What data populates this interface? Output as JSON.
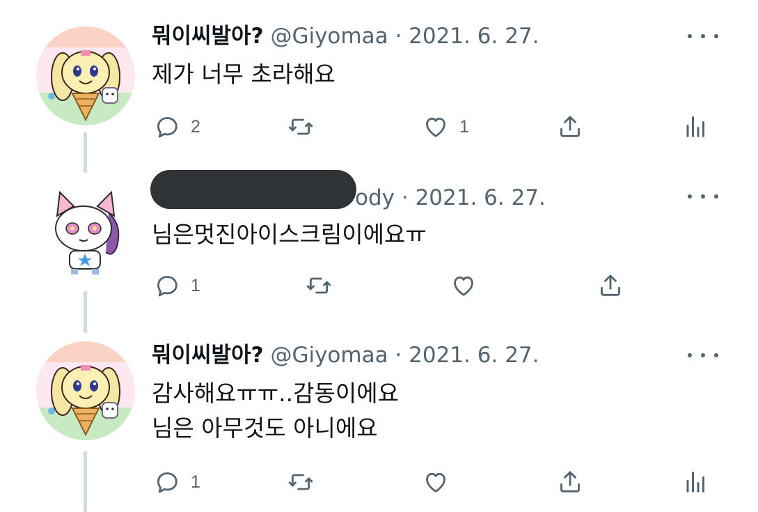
{
  "tweets": [
    {
      "display_name": "뭐이씨발아?",
      "handle": "@Giyomaa",
      "separator": " · ",
      "date": "2021. 6. 27.",
      "lines": [
        "제가 너무 초라해요"
      ],
      "reply_count": "2",
      "retweet_count": "",
      "like_count": "1"
    },
    {
      "display_name": "",
      "handle": "ody",
      "separator": " · ",
      "date": "2021. 6. 27.",
      "lines": [
        "님은멋진아이스크림이에요ㅠ"
      ],
      "reply_count": "1",
      "retweet_count": "",
      "like_count": ""
    },
    {
      "display_name": "뭐이씨발아?",
      "handle": "@Giyomaa",
      "separator": " · ",
      "date": "2021. 6. 27.",
      "lines": [
        "감사해요ㅠㅠ..감동이에요",
        "님은 아무것도 아니에요"
      ],
      "reply_count": "1",
      "retweet_count": "",
      "like_count": ""
    }
  ],
  "icons": [
    "reply-icon",
    "retweet-icon",
    "like-icon",
    "share-icon",
    "analytics-icon",
    "more-icon"
  ],
  "colors": {
    "text": "#0f1419",
    "secondary": "#536471",
    "thread_line": "#cfd9de",
    "redaction": "#2f3336"
  }
}
